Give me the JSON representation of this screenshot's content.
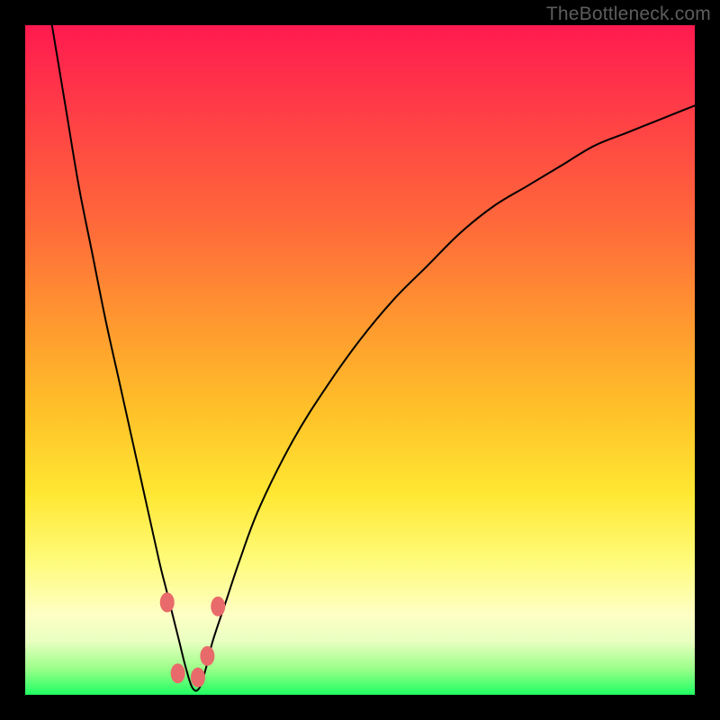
{
  "watermark": "TheBottleneck.com",
  "chart_data": {
    "type": "line",
    "title": "",
    "xlabel": "",
    "ylabel": "",
    "xlim": [
      0,
      100
    ],
    "ylim": [
      0,
      100
    ],
    "grid": false,
    "legend": false,
    "series": [
      {
        "name": "curve",
        "x": [
          4,
          6,
          8,
          10,
          12,
          14,
          16,
          18,
          20,
          21,
          22,
          23,
          24,
          25,
          26,
          27,
          28,
          30,
          32,
          35,
          40,
          45,
          50,
          55,
          60,
          65,
          70,
          75,
          80,
          85,
          90,
          95,
          100
        ],
        "y": [
          100,
          88,
          76,
          66,
          56,
          47,
          38,
          29,
          20,
          16,
          12,
          8,
          4,
          1,
          1,
          4,
          8,
          14,
          20,
          28,
          38,
          46,
          53,
          59,
          64,
          69,
          73,
          76,
          79,
          82,
          84,
          86,
          88
        ]
      }
    ],
    "markers": [
      {
        "x": 21.2,
        "y": 13.8
      },
      {
        "x": 22.8,
        "y": 3.2
      },
      {
        "x": 25.8,
        "y": 2.6
      },
      {
        "x": 27.2,
        "y": 5.8
      },
      {
        "x": 28.8,
        "y": 13.2
      }
    ],
    "colors": {
      "curve": "#000000",
      "marker_fill": "#e96a6a",
      "marker_stroke": "#c94e4e"
    }
  }
}
